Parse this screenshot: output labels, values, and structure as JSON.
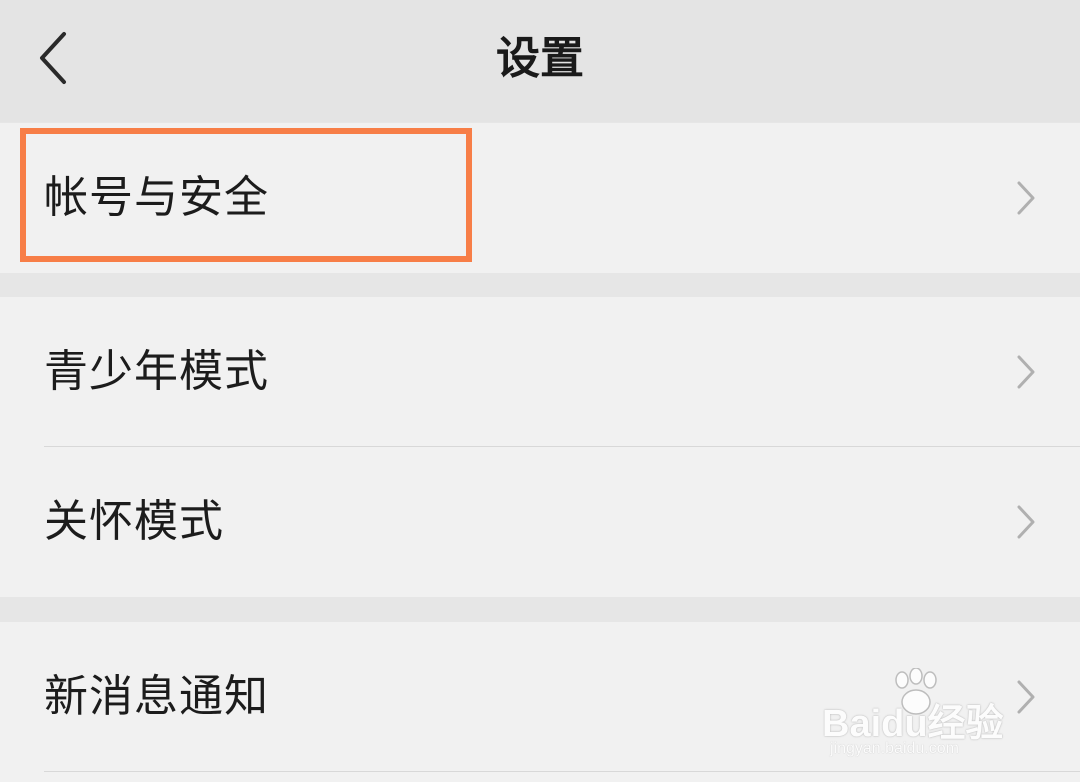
{
  "nav": {
    "title": "设置",
    "back_icon": "chevron-left-icon"
  },
  "groups": [
    {
      "rows": [
        {
          "label": "帐号与安全",
          "icon": "chevron-right-icon"
        }
      ]
    },
    {
      "rows": [
        {
          "label": "青少年模式",
          "icon": "chevron-right-icon"
        },
        {
          "label": "关怀模式",
          "icon": "chevron-right-icon"
        }
      ]
    },
    {
      "rows": [
        {
          "label": "新消息通知",
          "icon": "chevron-right-icon"
        }
      ]
    }
  ],
  "highlight": {
    "target": "帐号与安全",
    "color": "#f77e47"
  },
  "watermark": {
    "brand": "Baidu经验",
    "url": "jingyan.baidu.com"
  },
  "colors": {
    "background": "#e6e6e6",
    "row_background": "#f1f1f1",
    "chevron": "#b0b0b0",
    "text": "#1c1c1c"
  }
}
